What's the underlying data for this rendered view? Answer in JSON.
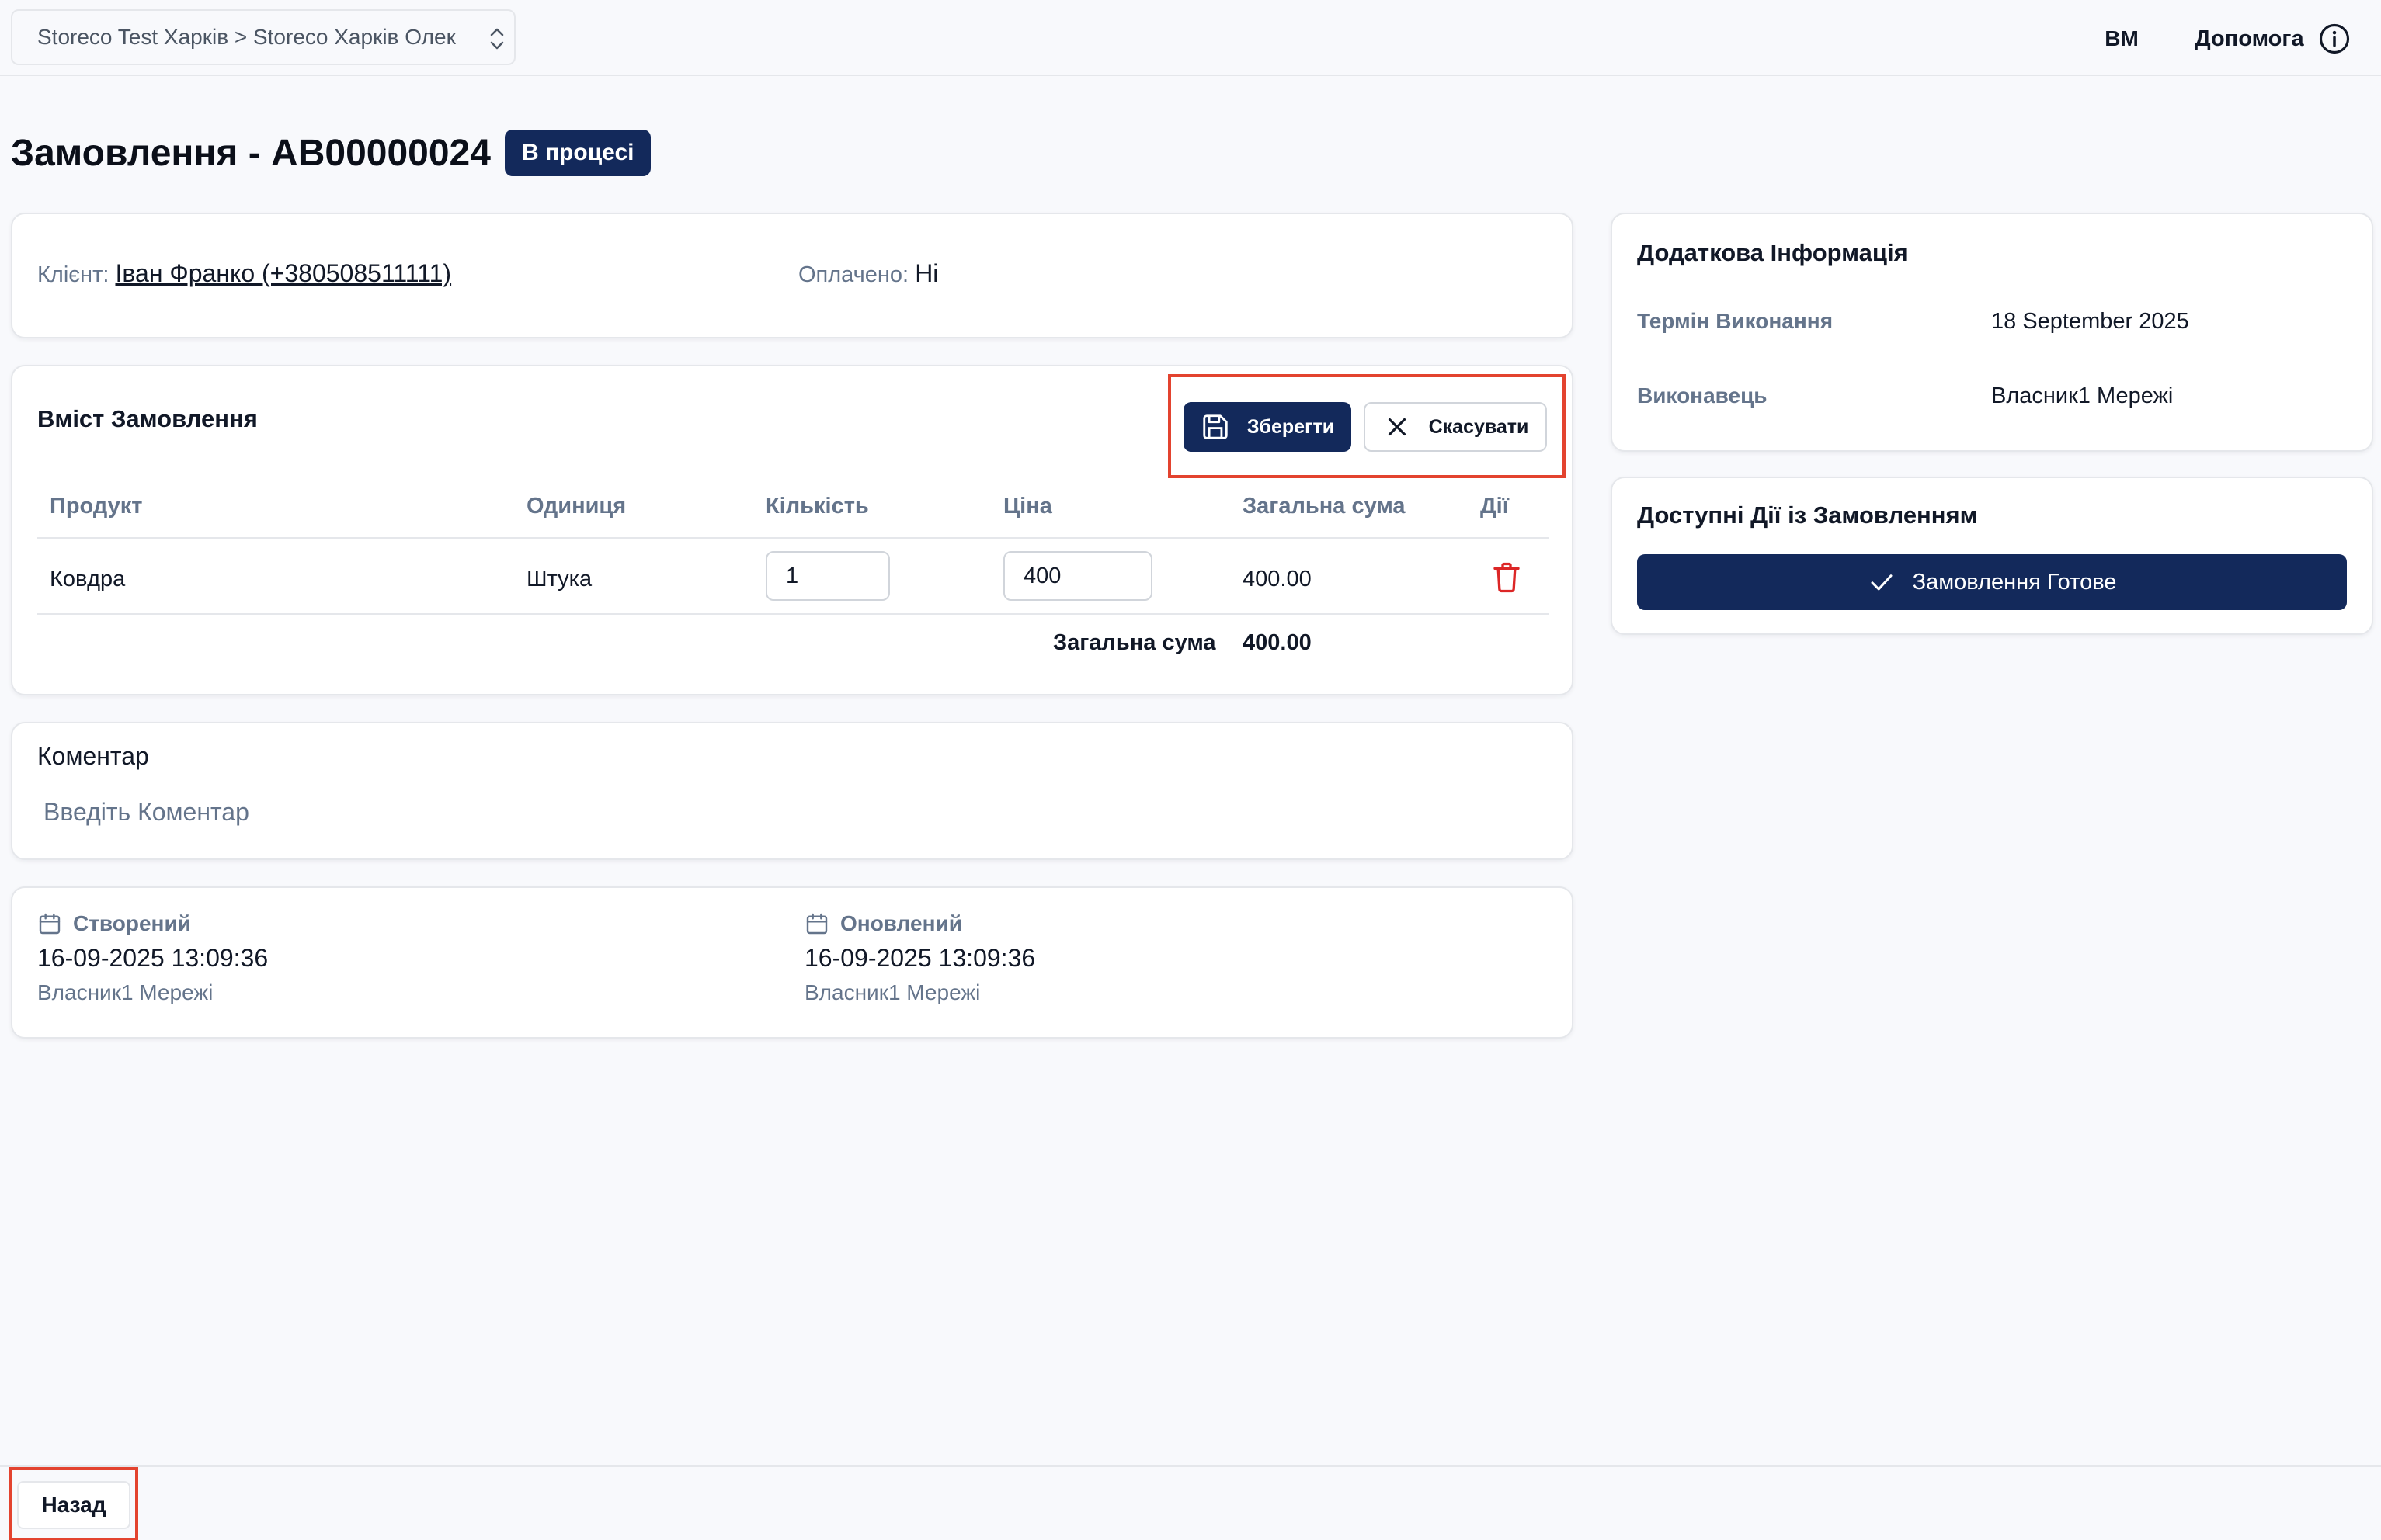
{
  "topbar": {
    "store_selector": "Storeco Test Харків > Storeco Харків Олек",
    "avatar_initials": "ВМ",
    "help_label": "Допомога"
  },
  "header": {
    "title": "Замовлення - AB00000024",
    "status": "В процесі"
  },
  "client": {
    "client_label": "Клієнт:",
    "client_value": "Іван Франко (+380508511111)",
    "paid_label": "Оплачено:",
    "paid_value": "Ні"
  },
  "order_content": {
    "title": "Вміст Замовлення",
    "save_label": "Зберегти",
    "cancel_label": "Скасувати",
    "columns": [
      "Продукт",
      "Одиниця",
      "Кількість",
      "Ціна",
      "Загальна сума",
      "Дії"
    ],
    "rows": [
      {
        "product": "Ковдра",
        "unit": "Штука",
        "quantity": "1",
        "price": "400",
        "total": "400.00"
      }
    ],
    "total_label": "Загальна сума",
    "total_value": "400.00"
  },
  "comment": {
    "title": "Коментар",
    "placeholder": "Введіть Коментар"
  },
  "dates": {
    "created_label": "Створений",
    "created_value": "16-09-2025 13:09:36",
    "created_by": "Власник1 Мережі",
    "updated_label": "Оновлений",
    "updated_value": "16-09-2025 13:09:36",
    "updated_by": "Власник1 Мережі"
  },
  "additional_info": {
    "title": "Додаткова Інформація",
    "deadline_label": "Термін Виконання",
    "deadline_value": "18 September 2025",
    "executor_label": "Виконавець",
    "executor_value": "Власник1 Мережі"
  },
  "available_actions": {
    "title": "Доступні Дії із Замовленням",
    "ready_label": "Замовлення Готове"
  },
  "footer": {
    "back_label": "Назад"
  },
  "colors": {
    "primary": "#13295b",
    "highlight": "#e3432f",
    "danger": "#dc2626",
    "background": "#f8f9fc"
  }
}
